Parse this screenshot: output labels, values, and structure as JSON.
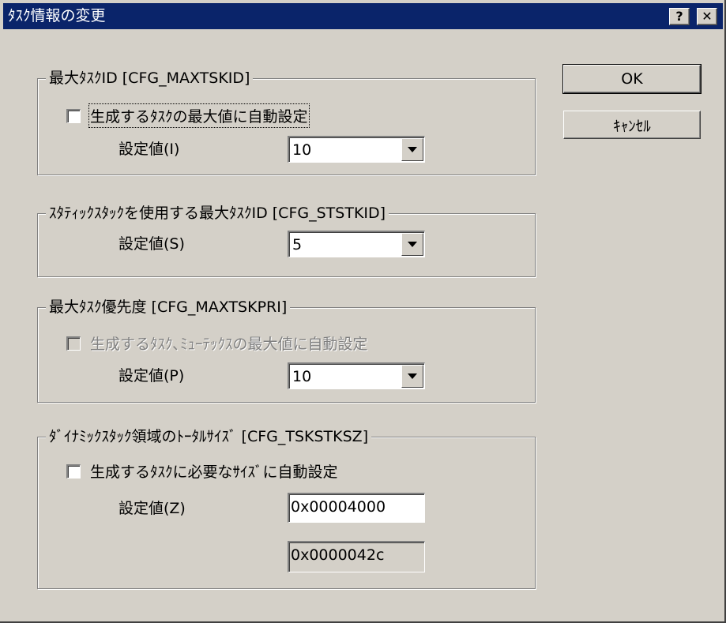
{
  "window": {
    "title": "ﾀｽｸ情報の変更",
    "help_label": "?",
    "close_label": "✕"
  },
  "buttons": {
    "ok_label": "OK",
    "cancel_label": "ｷｬﾝｾﾙ"
  },
  "max_task_id": {
    "legend": "最大ﾀｽｸID [CFG_MAXTSKID]",
    "checkbox_label": "生成するﾀｽｸの最大値に自動設定",
    "checkbox_checked": false,
    "value_label": "設定値(I)",
    "value": "10"
  },
  "static_stack": {
    "legend": "ｽﾀﾃｨｯｸｽﾀｯｸを使用する最大ﾀｽｸID [CFG_STSTKID]",
    "value_label": "設定値(S)",
    "value": "5"
  },
  "max_priority": {
    "legend": "最大ﾀｽｸ優先度 [CFG_MAXTSKPRI]",
    "checkbox_label": "生成するﾀｽｸ､ﾐｭｰﾃｯｸｽの最大値に自動設定",
    "checkbox_checked": false,
    "checkbox_enabled": false,
    "value_label": "設定値(P)",
    "value": "10"
  },
  "dynamic_stack": {
    "legend": "ﾀﾞｲﾅﾐｯｸｽﾀｯｸ領域のﾄｰﾀﾙｻｲｽﾞ [CFG_TSKSTKSZ]",
    "checkbox_label": "生成するﾀｽｸに必要なｻｲｽﾞに自動設定",
    "checkbox_checked": false,
    "value_label": "設定値(Z)",
    "value": "0x00004000",
    "computed_value": "0x0000042c"
  }
}
